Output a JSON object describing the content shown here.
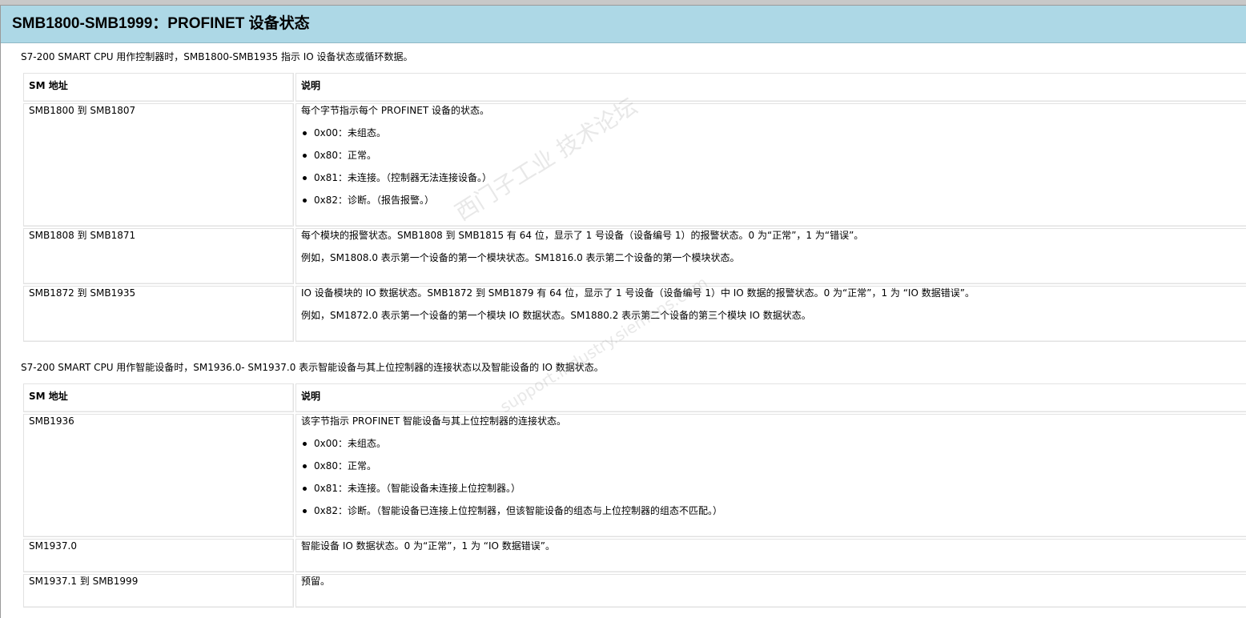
{
  "page": {
    "title": "SMB1800-SMB1999：PROFINET 设备状态"
  },
  "section1": {
    "intro": "S7-200 SMART CPU 用作控制器时，SMB1800-SMB1935 指示 IO 设备状态或循环数据。",
    "headers": [
      "SM 地址",
      "说明"
    ],
    "rows": [
      {
        "addr": "SMB1800 到 SMB1807",
        "lines": [
          "每个字节指示每个 PROFINET 设备的状态。"
        ],
        "bullets": [
          "0x00：未组态。",
          "0x80：正常。",
          "0x81：未连接。（控制器无法连接设备。）",
          "0x82：诊断。（报告报警。）"
        ]
      },
      {
        "addr": "SMB1808 到 SMB1871",
        "lines": [
          "每个模块的报警状态。SMB1808 到 SMB1815 有 64 位，显示了 1 号设备（设备编号 1）的报警状态。0 为“正常”，1 为“错误”。",
          "例如，SM1808.0 表示第一个设备的第一个模块状态。SM1816.0 表示第二个设备的第一个模块状态。"
        ]
      },
      {
        "addr": "SMB1872 到 SMB1935",
        "lines": [
          "IO 设备模块的 IO 数据状态。SMB1872 到 SMB1879 有 64 位，显示了 1 号设备（设备编号 1）中 IO 数据的报警状态。0 为“正常”，1 为 “IO 数据错误”。",
          "例如，SM1872.0 表示第一个设备的第一个模块 IO 数据状态。SM1880.2 表示第二个设备的第三个模块 IO 数据状态。"
        ]
      }
    ]
  },
  "section2": {
    "intro": "S7-200 SMART CPU 用作智能设备时，SM1936.0- SM1937.0 表示智能设备与其上位控制器的连接状态以及智能设备的 IO 数据状态。",
    "headers": [
      "SM 地址",
      "说明"
    ],
    "rows": [
      {
        "addr": "SMB1936",
        "lines": [
          "该字节指示 PROFINET 智能设备与其上位控制器的连接状态。"
        ],
        "bullets": [
          "0x00：未组态。",
          "0x80：正常。",
          "0x81：未连接。（智能设备未连接上位控制器。）",
          "0x82：诊断。（智能设备已连接上位控制器，但该智能设备的组态与上位控制器的组态不匹配。）"
        ]
      },
      {
        "addr": "SM1937.0",
        "lines": [
          "智能设备 IO 数据状态。0 为“正常”，1 为 “IO 数据错误”。"
        ]
      },
      {
        "addr": "SM1937.1 到 SMB1999",
        "lines": [
          "预留。"
        ]
      }
    ]
  },
  "watermark": {
    "text": "西门子工业 技术论坛",
    "sub": "support.industry.siemens.com"
  },
  "colors": {
    "header_bg": "#add8e6",
    "cell_border": "#e2e2e2"
  }
}
